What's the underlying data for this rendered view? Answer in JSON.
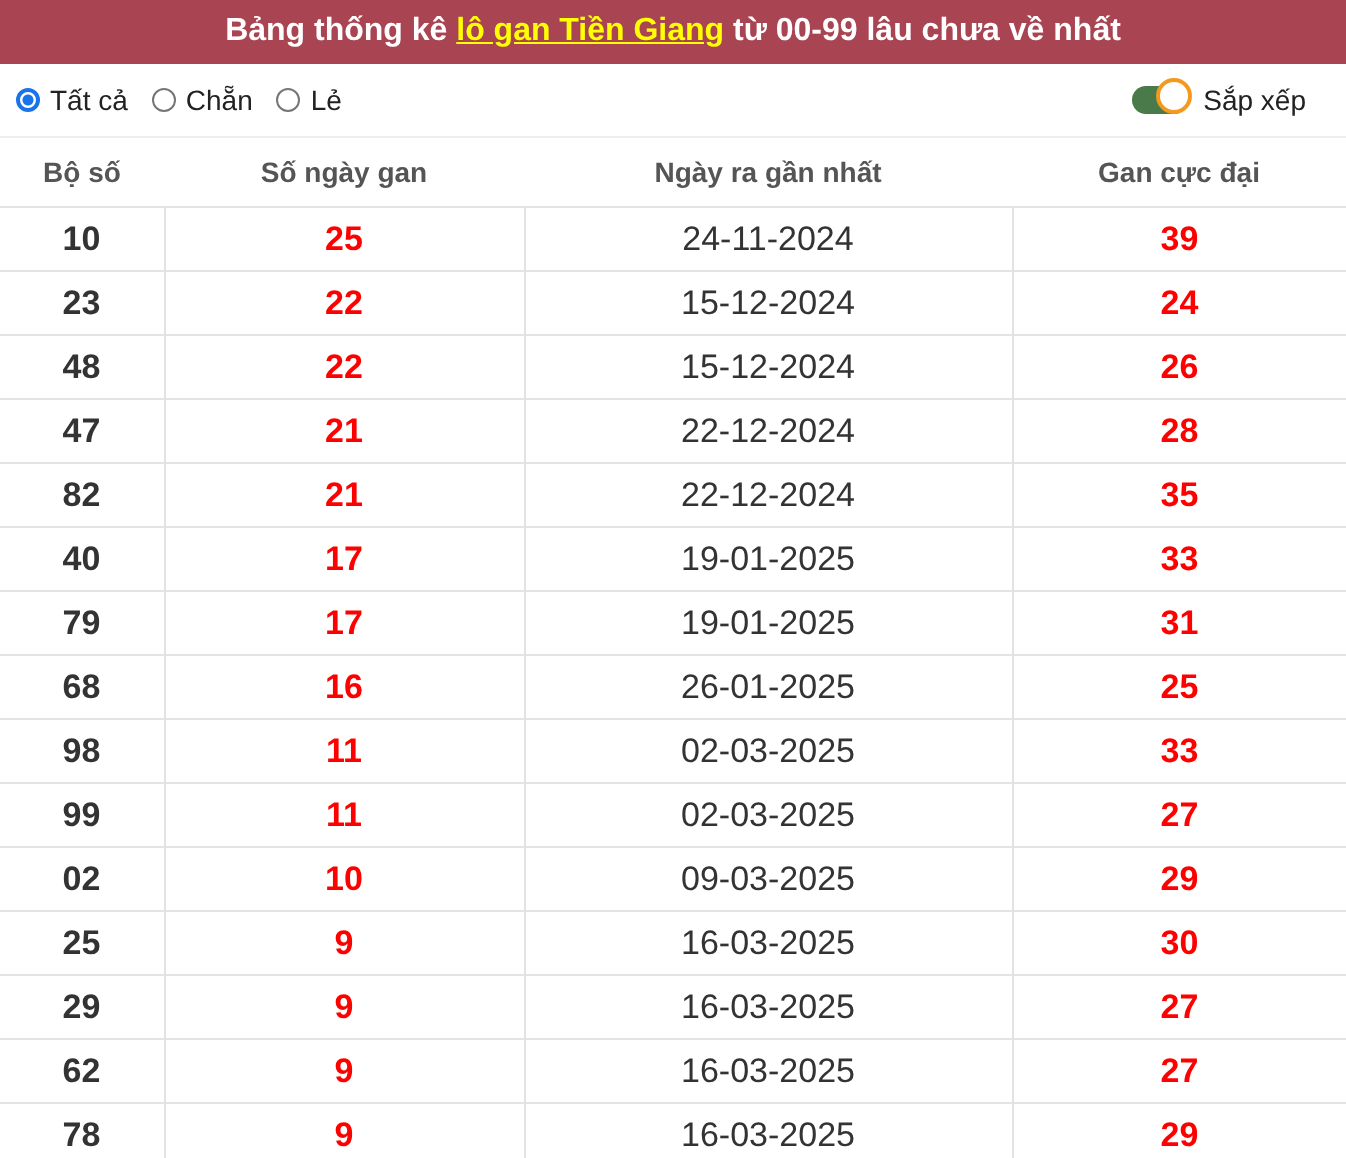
{
  "title": {
    "before": "Bảng thống kê ",
    "link": "lô gan Tiền Giang",
    "after": " từ 00-99 lâu chưa về nhất"
  },
  "filters": [
    {
      "label": "Tất cả",
      "selected": true
    },
    {
      "label": "Chẵn",
      "selected": false
    },
    {
      "label": "Lẻ",
      "selected": false
    }
  ],
  "sort_toggle": {
    "label": "Sắp xếp",
    "on": true
  },
  "table": {
    "columns": [
      "Bộ số",
      "Số ngày gan",
      "Ngày ra gần nhất",
      "Gan cực đại"
    ],
    "rows": [
      [
        "10",
        "25",
        "24-11-2024",
        "39"
      ],
      [
        "23",
        "22",
        "15-12-2024",
        "24"
      ],
      [
        "48",
        "22",
        "15-12-2024",
        "26"
      ],
      [
        "47",
        "21",
        "22-12-2024",
        "28"
      ],
      [
        "82",
        "21",
        "22-12-2024",
        "35"
      ],
      [
        "40",
        "17",
        "19-01-2025",
        "33"
      ],
      [
        "79",
        "17",
        "19-01-2025",
        "31"
      ],
      [
        "68",
        "16",
        "26-01-2025",
        "25"
      ],
      [
        "98",
        "11",
        "02-03-2025",
        "33"
      ],
      [
        "99",
        "11",
        "02-03-2025",
        "27"
      ],
      [
        "02",
        "10",
        "09-03-2025",
        "29"
      ],
      [
        "25",
        "9",
        "16-03-2025",
        "30"
      ],
      [
        "29",
        "9",
        "16-03-2025",
        "27"
      ],
      [
        "62",
        "9",
        "16-03-2025",
        "27"
      ],
      [
        "78",
        "9",
        "16-03-2025",
        "29"
      ]
    ]
  }
}
